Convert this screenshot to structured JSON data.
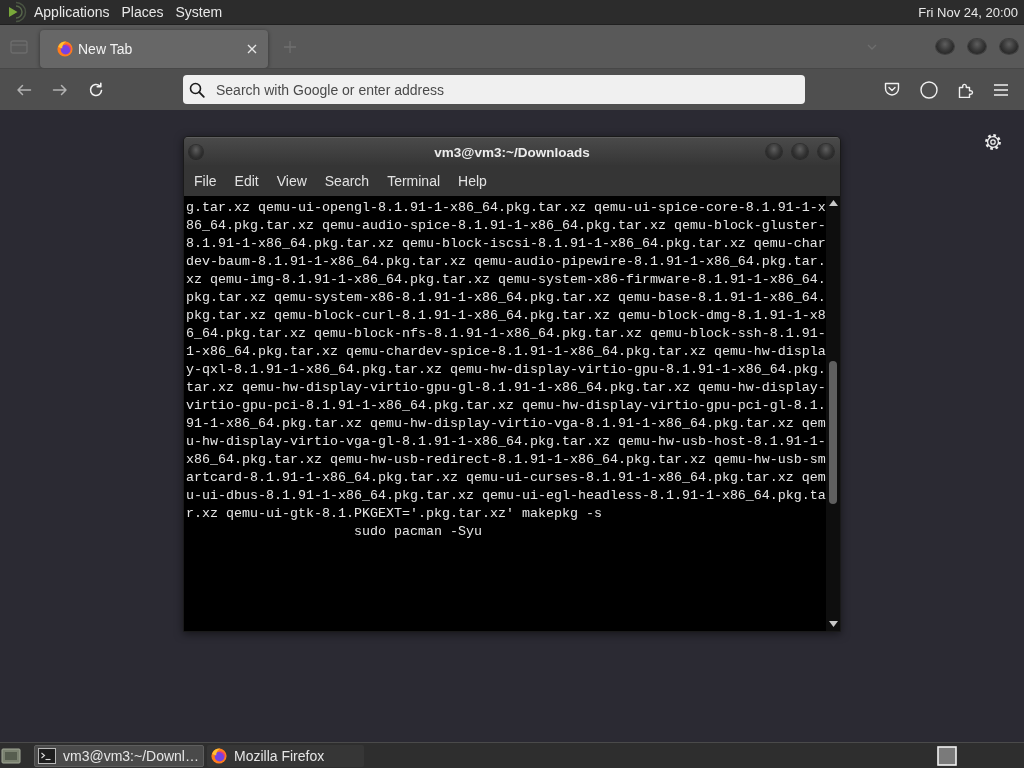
{
  "top_panel": {
    "menus": [
      "Applications",
      "Places",
      "System"
    ],
    "clock": "Fri Nov 24, 20:00"
  },
  "browser": {
    "tabs": [
      {
        "title": "New Tab",
        "selected": true
      }
    ],
    "navigation": {
      "back": {
        "disabled": true
      },
      "forward": {
        "disabled": true
      }
    },
    "address_bar": {
      "placeholder": "Search with Google or enter address"
    }
  },
  "terminal": {
    "title": "vm3@vm3:~/Downloads",
    "menus": [
      "File",
      "Edit",
      "View",
      "Search",
      "Terminal",
      "Help"
    ],
    "lines": [
      "g.tar.xz qemu-ui-opengl-8.1.91-1-x86_64.pkg.tar.xz qemu-ui-spice-core-8.1.91-1-x",
      "86_64.pkg.tar.xz qemu-audio-spice-8.1.91-1-x86_64.pkg.tar.xz qemu-block-gluster-",
      "8.1.91-1-x86_64.pkg.tar.xz qemu-block-iscsi-8.1.91-1-x86_64.pkg.tar.xz qemu-char",
      "dev-baum-8.1.91-1-x86_64.pkg.tar.xz qemu-audio-pipewire-8.1.91-1-x86_64.pkg.tar.",
      "xz qemu-img-8.1.91-1-x86_64.pkg.tar.xz qemu-system-x86-firmware-8.1.91-1-x86_64.",
      "pkg.tar.xz qemu-system-x86-8.1.91-1-x86_64.pkg.tar.xz qemu-base-8.1.91-1-x86_64.",
      "pkg.tar.xz qemu-block-curl-8.1.91-1-x86_64.pkg.tar.xz qemu-block-dmg-8.1.91-1-x8",
      "6_64.pkg.tar.xz qemu-block-nfs-8.1.91-1-x86_64.pkg.tar.xz qemu-block-ssh-8.1.91-",
      "1-x86_64.pkg.tar.xz qemu-chardev-spice-8.1.91-1-x86_64.pkg.tar.xz qemu-hw-displa",
      "y-qxl-8.1.91-1-x86_64.pkg.tar.xz qemu-hw-display-virtio-gpu-8.1.91-1-x86_64.pkg.",
      "tar.xz qemu-hw-display-virtio-gpu-gl-8.1.91-1-x86_64.pkg.tar.xz qemu-hw-display-",
      "virtio-gpu-pci-8.1.91-1-x86_64.pkg.tar.xz qemu-hw-display-virtio-gpu-pci-gl-8.1.",
      "91-1-x86_64.pkg.tar.xz qemu-hw-display-virtio-vga-8.1.91-1-x86_64.pkg.tar.xz qem",
      "u-hw-display-virtio-vga-gl-8.1.91-1-x86_64.pkg.tar.xz qemu-hw-usb-host-8.1.91-1-",
      "x86_64.pkg.tar.xz qemu-hw-usb-redirect-8.1.91-1-x86_64.pkg.tar.xz qemu-hw-usb-sm",
      "artcard-8.1.91-1-x86_64.pkg.tar.xz qemu-ui-curses-8.1.91-1-x86_64.pkg.tar.xz qem",
      "u-ui-dbus-8.1.91-1-x86_64.pkg.tar.xz qemu-ui-egl-headless-8.1.91-1-x86_64.pkg.ta",
      "r.xz qemu-ui-gtk-8.1.PKGEXT='.pkg.tar.xz' makepkg -s",
      "                     sudo pacman -Syu"
    ]
  },
  "taskbar": {
    "tasks": [
      {
        "kind": "terminal",
        "label": "vm3@vm3:~/Downl…",
        "selected": true
      },
      {
        "kind": "browser",
        "label": "Mozilla Firefox",
        "selected": false
      }
    ]
  }
}
